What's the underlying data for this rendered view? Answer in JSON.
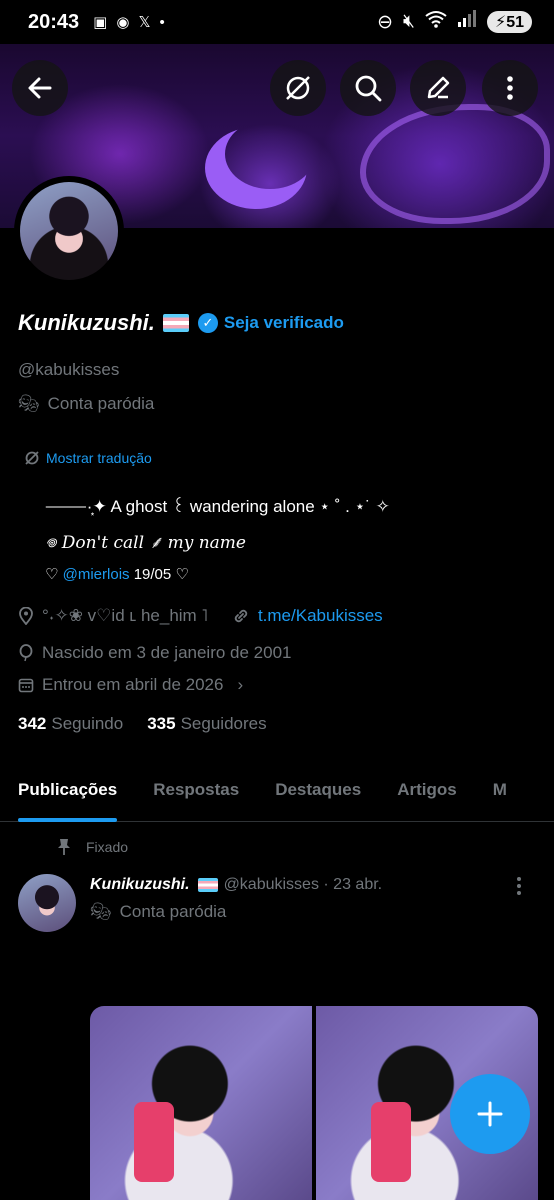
{
  "status_bar": {
    "time": "20:43",
    "x_glyph": "𝕏",
    "battery": "51"
  },
  "profile": {
    "display_name": "Kunikuzushi.",
    "verify_label": "Seja verificado",
    "handle": "@kabukisses",
    "parody_label": "Conta paródia",
    "translate_label": "Mostrar tradução",
    "bio_line1": "⸻·͙✦  A  ghost  ꒰  wandering  alone ⋆ ˚ . ⋆˙ ✧",
    "bio_line2": "𖦹   Don't  call  ⸙  my  name",
    "bio_line3_prefix": "♡",
    "bio_mention": "@mierlois",
    "bio_line3_suffix": "19/05 ♡",
    "location": "°˖✧❀ v♡id ʟ he_him ˥",
    "link": "t.me/Kabukisses",
    "born": "Nascido em 3 de janeiro de 2001",
    "joined": "Entrou em abril de 2026",
    "following_count": "342",
    "following_label": "Seguindo",
    "followers_count": "335",
    "followers_label": "Seguidores"
  },
  "tabs": [
    {
      "label": "Publicações"
    },
    {
      "label": "Respostas"
    },
    {
      "label": "Destaques"
    },
    {
      "label": "Artigos"
    },
    {
      "label": "M"
    }
  ],
  "post": {
    "pinned_label": "Fixado",
    "name": "Kunikuzushi.",
    "handle_time": "@kabukisses · 23 abr.",
    "parody_label": "Conta paródia"
  },
  "colors": {
    "accent": "#1d9bf0",
    "background": "#000000",
    "muted": "#71767b"
  }
}
